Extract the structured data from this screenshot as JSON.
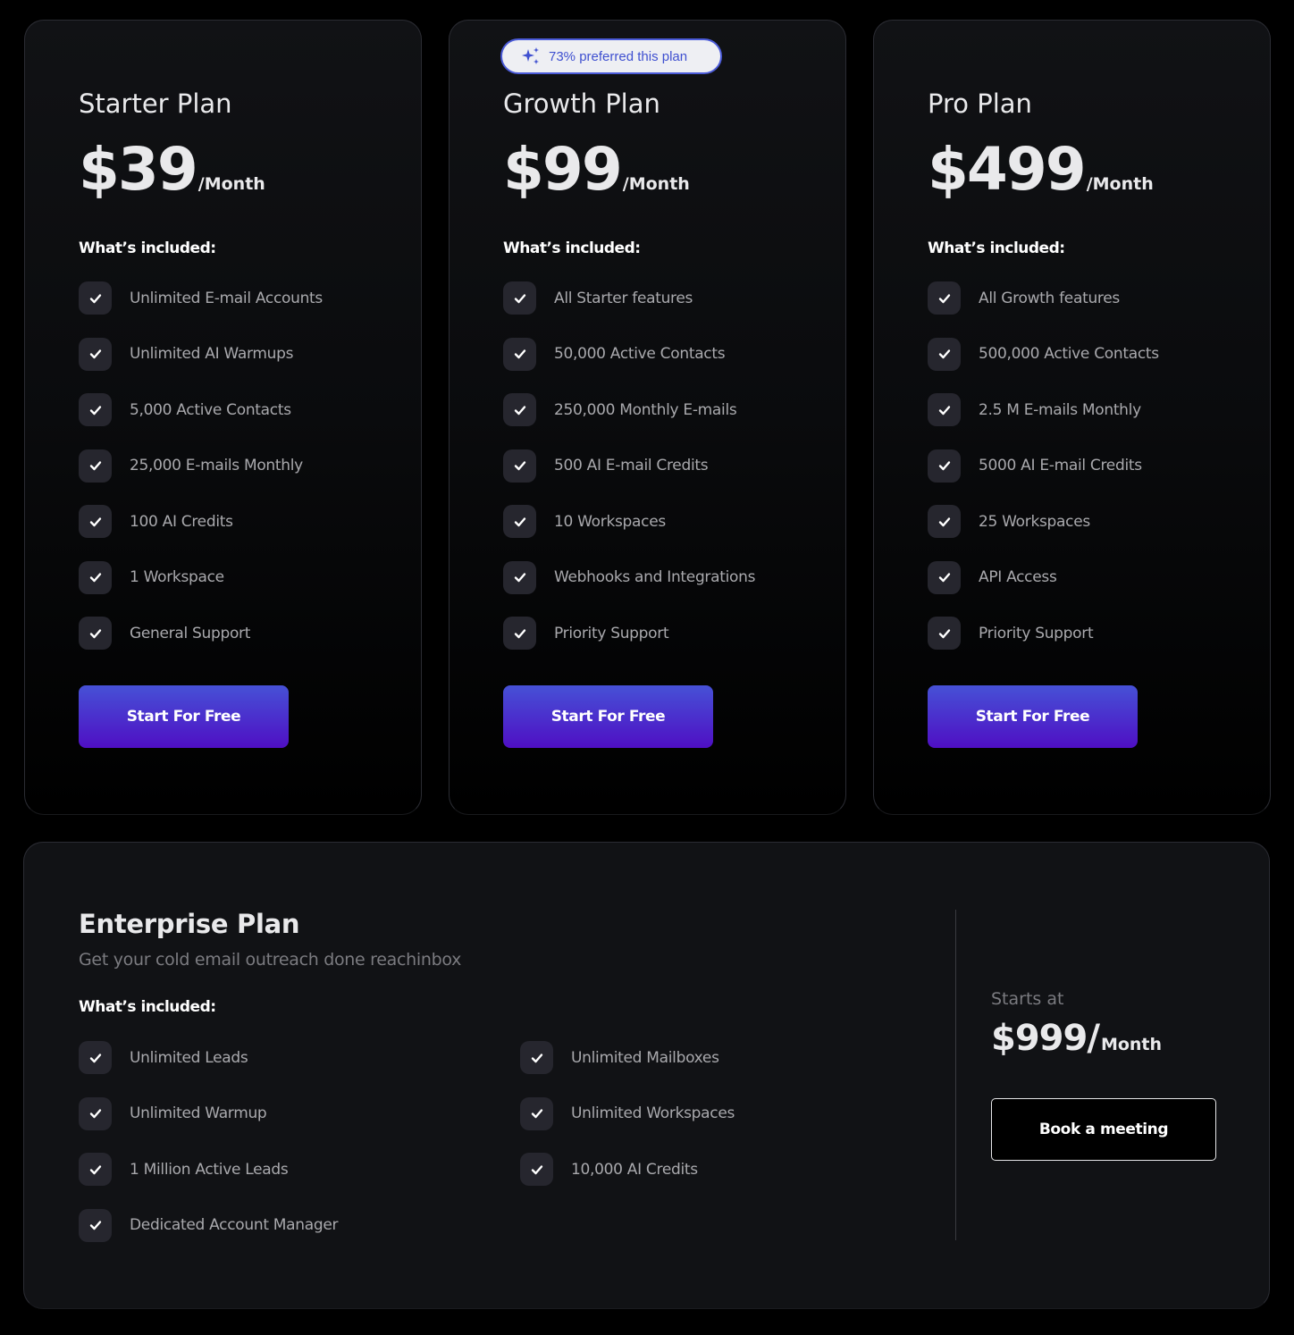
{
  "plans": [
    {
      "name": "Starter Plan",
      "price": "$39",
      "period": "/Month",
      "included_label": "What’s included:",
      "features": [
        "Unlimited E-mail Accounts",
        "Unlimited AI Warmups",
        "5,000 Active Contacts",
        "25,000 E-mails Monthly",
        "100 AI Credits",
        "1 Workspace",
        "General Support"
      ],
      "cta_label": "Start For Free"
    },
    {
      "name": "Growth Plan",
      "badge": "73% preferred this plan",
      "badge_icon": "sparkles-icon",
      "price": "$99",
      "period": "/Month",
      "included_label": "What’s included:",
      "features": [
        "All Starter features",
        "50,000 Active Contacts",
        "250,000 Monthly E-mails",
        "500 AI E-mail Credits",
        "10 Workspaces",
        "Webhooks and Integrations",
        "Priority Support"
      ],
      "cta_label": "Start For Free"
    },
    {
      "name": "Pro Plan",
      "price": "$499",
      "period": "/Month",
      "included_label": "What’s included:",
      "features": [
        "All Growth features",
        "500,000 Active Contacts",
        "2.5 M E-mails Monthly",
        "5000 AI E-mail Credits",
        "25 Workspaces",
        "API Access",
        "Priority Support"
      ],
      "cta_label": "Start For Free"
    }
  ],
  "enterprise": {
    "name": "Enterprise Plan",
    "subtitle": "Get your cold email outreach done reachinbox",
    "included_label": "What’s included:",
    "features_left": [
      "Unlimited Leads",
      "Unlimited Warmup",
      "1 Million Active Leads",
      "Dedicated Account Manager"
    ],
    "features_right": [
      "Unlimited Mailboxes",
      "Unlimited Workspaces",
      "10,000 AI  Credits"
    ],
    "starts_at_label": "Starts at",
    "price": "$999/",
    "period": "Month",
    "cta_label": "Book a meeting"
  },
  "colors": {
    "accent_gradient_start": "#4651d6",
    "accent_gradient_end": "#4f0fc4",
    "badge_text": "#3f50d0",
    "background": "#000000",
    "card": "#111215"
  },
  "icons": {
    "check": "check-icon",
    "badge": "sparkles-icon"
  }
}
